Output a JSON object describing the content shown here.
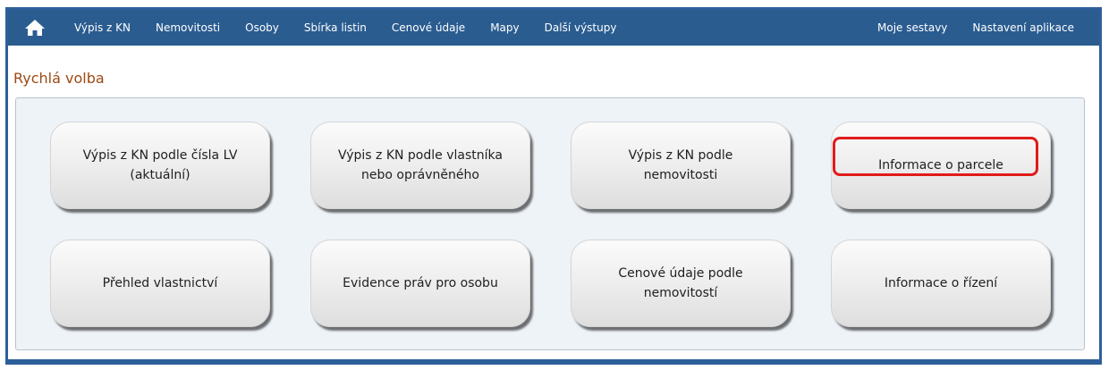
{
  "navbar": {
    "home_icon": "home-icon",
    "left_items": [
      "Výpis z KN",
      "Nemovitosti",
      "Osoby",
      "Sbírka listin",
      "Cenové údaje",
      "Mapy",
      "Další výstupy"
    ],
    "right_items": [
      "Moje sestavy",
      "Nastavení aplikace"
    ]
  },
  "section": {
    "title": "Rychlá volba"
  },
  "tiles": [
    "Výpis z KN podle čísla LV\n(aktuální)",
    "Výpis z KN podle vlastníka\nnebo oprávněného",
    "Výpis z KN podle\nnemovitosti",
    "Informace o parcele",
    "Přehled vlastnictví",
    "Evidence práv pro osobu",
    "Cenové údaje podle\nnemovitostí",
    "Informace o řízení"
  ],
  "colors": {
    "navbar": "#2a5c90",
    "frame": "#2d5f9a",
    "title": "#9c4a12",
    "highlight": "#e11b1b"
  }
}
